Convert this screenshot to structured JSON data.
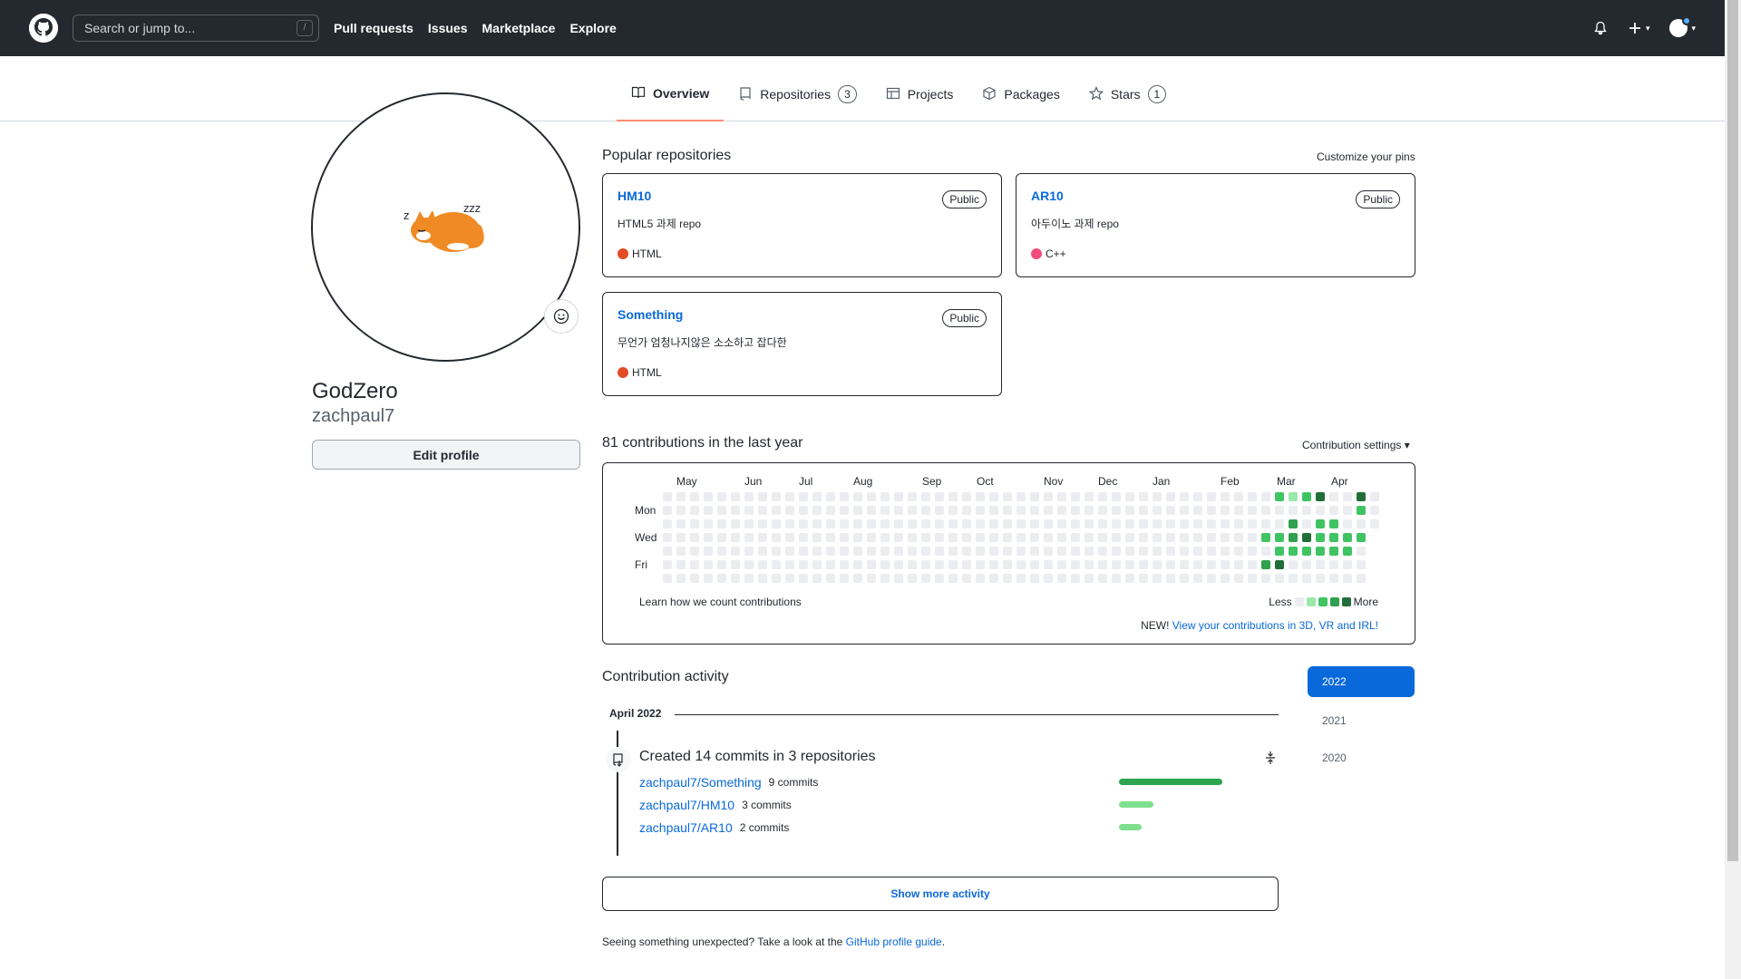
{
  "header": {
    "search_placeholder": "Search or jump to...",
    "search_shortcut": "/",
    "nav": [
      "Pull requests",
      "Issues",
      "Marketplace",
      "Explore"
    ],
    "icons": [
      "bell-icon",
      "plus-icon",
      "avatar-icon"
    ]
  },
  "tabs": [
    {
      "label": "Overview",
      "icon": "book-icon",
      "count": null,
      "active": true
    },
    {
      "label": "Repositories",
      "icon": "repo-icon",
      "count": "3",
      "active": false
    },
    {
      "label": "Projects",
      "icon": "table-icon",
      "count": null,
      "active": false
    },
    {
      "label": "Packages",
      "icon": "package-icon",
      "count": null,
      "active": false
    },
    {
      "label": "Stars",
      "icon": "star-icon",
      "count": "1",
      "active": false
    }
  ],
  "profile": {
    "fullname": "GodZero",
    "username": "zachpaul7",
    "edit_label": "Edit profile"
  },
  "popular": {
    "title": "Popular repositories",
    "customize": "Customize your pins",
    "repos": [
      {
        "name": "HM10",
        "badge": "Public",
        "desc": "HTML5 과제 repo",
        "lang": "HTML",
        "lang_color": "#e34c26"
      },
      {
        "name": "AR10",
        "badge": "Public",
        "desc": "아두이노 과제 repo",
        "lang": "C++",
        "lang_color": "#f34b7d"
      },
      {
        "name": "Something",
        "badge": "Public",
        "desc": "무언가 엄청나지않은 소소하고 잡다한",
        "lang": "HTML",
        "lang_color": "#e34c26"
      }
    ]
  },
  "contributions": {
    "title": "81 contributions in the last year",
    "settings": "Contribution settings",
    "months": [
      "May",
      "Jun",
      "Jul",
      "Aug",
      "Sep",
      "Oct",
      "Nov",
      "Dec",
      "Jan",
      "Feb",
      "Mar",
      "Apr"
    ],
    "days": [
      "Mon",
      "Wed",
      "Fri"
    ],
    "learn": "Learn how we count contributions",
    "less": "Less",
    "more": "More",
    "new_prefix": "NEW!",
    "new_link": "View your contributions in 3D, VR and IRL!",
    "colors": [
      "#ebedf0",
      "#9be9a8",
      "#40c463",
      "#30a14e",
      "#216e39"
    ]
  },
  "activity": {
    "title": "Contribution activity",
    "years": [
      "2022",
      "2021",
      "2020"
    ],
    "month": "April 2022",
    "headline": "Created 14 commits in 3 repositories",
    "rows": [
      {
        "repo": "zachpaul7/Something",
        "commits": "9 commits",
        "value": 9
      },
      {
        "repo": "zachpaul7/HM10",
        "commits": "3 commits",
        "value": 3
      },
      {
        "repo": "zachpaul7/AR10",
        "commits": "2 commits",
        "value": 2
      }
    ],
    "show_more": "Show more activity",
    "footer_text": "Seeing something unexpected? Take a look at the",
    "footer_link": "GitHub profile guide",
    "footer_end": "."
  }
}
